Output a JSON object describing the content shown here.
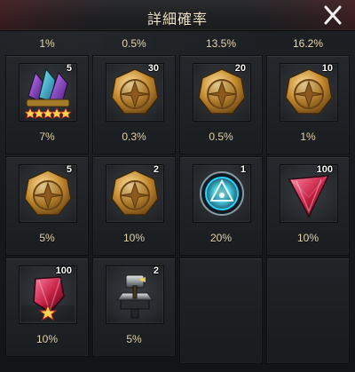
{
  "header": {
    "title": "詳細確率"
  },
  "icons": {
    "close": "close-icon"
  },
  "top_row": [
    "1%",
    "0.5%",
    "13.5%",
    "16.2%"
  ],
  "rows": [
    [
      {
        "icon": "gem-cluster-5-star-icon",
        "qty": "5",
        "prob": "7%"
      },
      {
        "icon": "gold-emblem-icon",
        "qty": "30",
        "prob": "0.3%"
      },
      {
        "icon": "gold-emblem-icon",
        "qty": "20",
        "prob": "0.5%"
      },
      {
        "icon": "gold-emblem-icon",
        "qty": "10",
        "prob": "1%"
      }
    ],
    [
      {
        "icon": "gold-emblem-icon",
        "qty": "5",
        "prob": "5%"
      },
      {
        "icon": "gold-emblem-icon",
        "qty": "2",
        "prob": "10%"
      },
      {
        "icon": "blue-triangle-core-icon",
        "qty": "1",
        "prob": "20%"
      },
      {
        "icon": "red-crystal-shard-icon",
        "qty": "100",
        "prob": "10%"
      }
    ],
    [
      {
        "icon": "red-crystal-1-star-icon",
        "qty": "100",
        "prob": "10%"
      },
      {
        "icon": "anvil-hammer-icon",
        "qty": "2",
        "prob": "5%"
      }
    ]
  ],
  "colors": {
    "title": "#f2e6c8",
    "text": "#e7d7ae",
    "panel": "#1a1d20",
    "accent_red": "#8c181c"
  }
}
